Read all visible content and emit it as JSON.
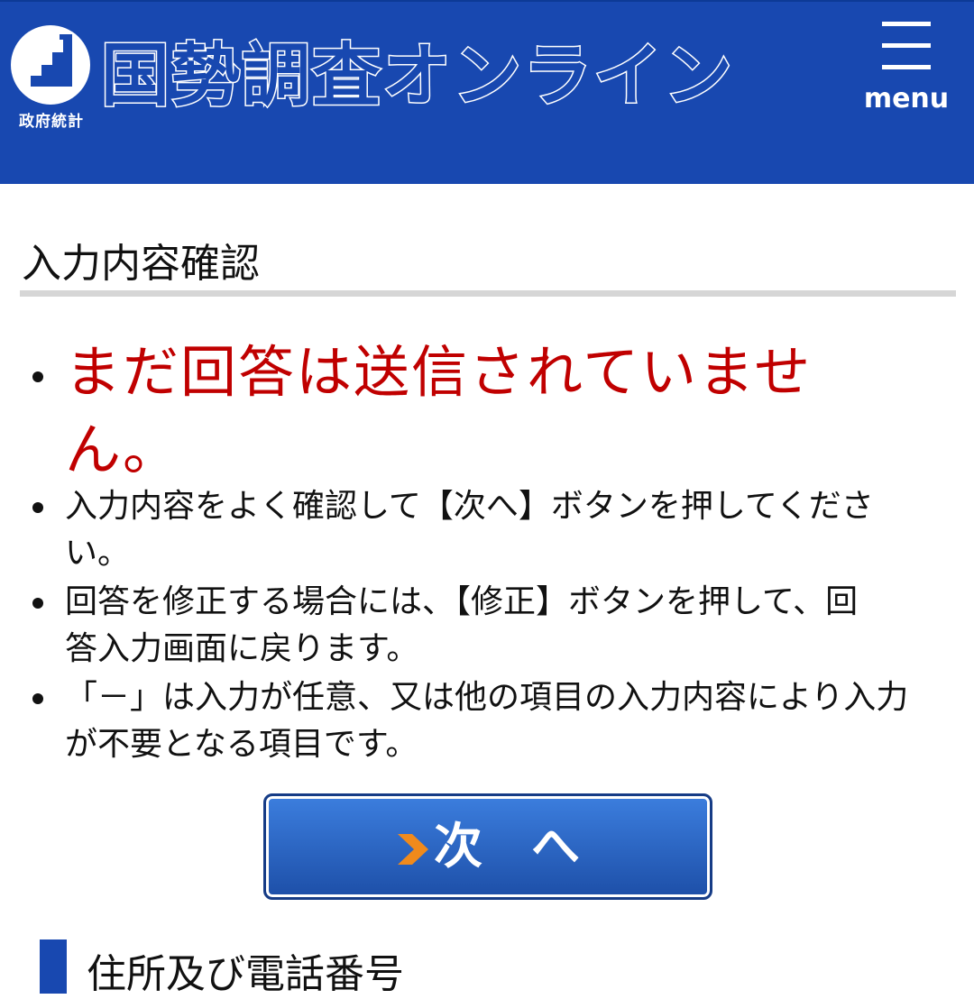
{
  "header": {
    "logo_caption": "政府統計",
    "site_title": "国勢調査オンライン",
    "menu_label": "menu"
  },
  "page": {
    "title": "入力内容確認"
  },
  "notes": [
    "まだ回答は送信されていません。",
    "入力内容をよく確認して【次へ】ボタンを押してください。",
    "回答を修正する場合には、【修正】ボタンを押して、回答入力画面に戻ります。",
    "「－」は入力が任意、又は他の項目の入力内容により入力が不要となる項目です。"
  ],
  "next_button": {
    "label": "次　へ"
  },
  "section": {
    "heading": "住所及び電話番号"
  },
  "colors": {
    "header_bg": "#1848b0",
    "warning_text": "#c00000",
    "button_bg": "#2c66c4",
    "arrow": "#f08a1c"
  }
}
